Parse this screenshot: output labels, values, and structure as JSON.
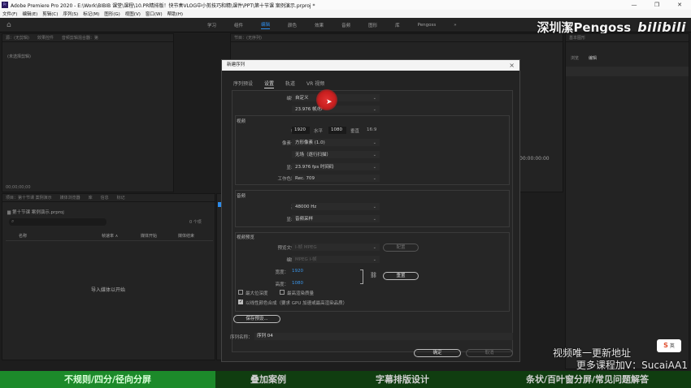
{
  "window": {
    "title": "Adobe Premiere Pro 2020 - E:\\Work\\BIBIB 课堂\\课程\\10.PR精排版！快节奏VLOG中小剪技巧和精\\课件\\PPT\\第十节课 案例演示.prproj *",
    "app_badge": "Pr",
    "controls": [
      "—",
      "❐",
      "✕"
    ]
  },
  "menubar": [
    "文件(F)",
    "编辑(E)",
    "剪辑(C)",
    "序列(S)",
    "标记(M)",
    "图形(G)",
    "视图(V)",
    "窗口(W)",
    "帮助(H)"
  ],
  "workspace": {
    "home_icon": "home-icon",
    "tabs": [
      "学习",
      "组件",
      "编辑",
      "颜色",
      "效果",
      "音频",
      "图形",
      "库",
      "Pengoss",
      "»"
    ],
    "active": "编辑"
  },
  "watermark": {
    "name": "深圳潔Pengoss",
    "logo": "bilibili"
  },
  "panels": {
    "source": {
      "tabs": [
        "源：(无剪辑)",
        "效果控件",
        "音频剪辑混合器：第"
      ],
      "body": "(未选择剪辑)",
      "timecode": "00;00;00;00"
    },
    "program": {
      "tabs": [
        "节目：(无序列)"
      ],
      "timecode": "00:00:00:00"
    },
    "right": {
      "title": "基本图形",
      "tabs": [
        "浏览",
        "编辑"
      ]
    },
    "project": {
      "tabs": [
        "项目：第十节课 案例演示",
        "媒体浏览器",
        "库",
        "信息",
        "标记"
      ],
      "file": "第十节课 案例演示.prproj",
      "search_placeholder": "",
      "count_label": "0 个项",
      "columns": [
        "名称",
        "帧速率 ∧",
        "媒体开始",
        "媒体结束"
      ],
      "empty": "导入媒体以开始"
    }
  },
  "dialog": {
    "title": "新建序列",
    "tabs": [
      "序列预设",
      "设置",
      "轨道",
      "VR 视频"
    ],
    "active_tab": "设置",
    "editing_mode_label": "编辑模式：",
    "editing_mode": "自定义",
    "timebase_label": "时基：",
    "timebase": "23.976 帧/秒",
    "video_section": "视频",
    "frame_size_label": "帧大小：",
    "frame_w": "1920",
    "frame_h_label": "水平",
    "frame_h": "1080",
    "frame_v_label": "垂直",
    "aspect": "16:9",
    "pixel_aspect_label": "像素长宽比：",
    "pixel_aspect": "方形像素 (1.0)",
    "fields_label": "场：",
    "fields": "无场（逐行扫描）",
    "display_label": "显示格式：",
    "display": "23.976 fps 时间码",
    "colorspace_label": "工作色彩空间：",
    "colorspace": "Rec. 709",
    "audio_section": "音频",
    "sample_rate_label": "采样率：",
    "sample_rate": "48000 Hz",
    "audio_display_label": "显示格式：",
    "audio_display": "音频采样",
    "preview_section": "视频预览",
    "preview_format_label": "预览文件格式：",
    "preview_format": "I-帧 MPEG",
    "configure": "配置",
    "codec_label": "编解码器：",
    "codec": "MPEG I-帧",
    "width_label": "宽度：",
    "width": "1920",
    "height_label": "高度：",
    "height": "1080",
    "reset": "重置",
    "max_depth": "最大位深度",
    "max_quality": "最高渲染质量",
    "linear_color": "以线性颜色合成（要求 GPU 加速或最高渲染品质）",
    "save_preset": "保存预设...",
    "seq_name_label": "序列名称：",
    "seq_name": "序列 04",
    "ok": "确定",
    "cancel": "取消"
  },
  "overlay": {
    "line1": "视频唯一更新地址",
    "line2": "更多课程加V：SucaiAA1",
    "ime": "英"
  },
  "banner": [
    "不规则/四分/径向分屏",
    "叠加案例",
    "字幕排版设计",
    "条状/百叶窗分屏/常见问题解答"
  ],
  "colors": {
    "accent": "#2d8ceb",
    "banner_active": "#1c8a2a",
    "banner_bg": "#103d10",
    "cursor": "#d42626"
  }
}
